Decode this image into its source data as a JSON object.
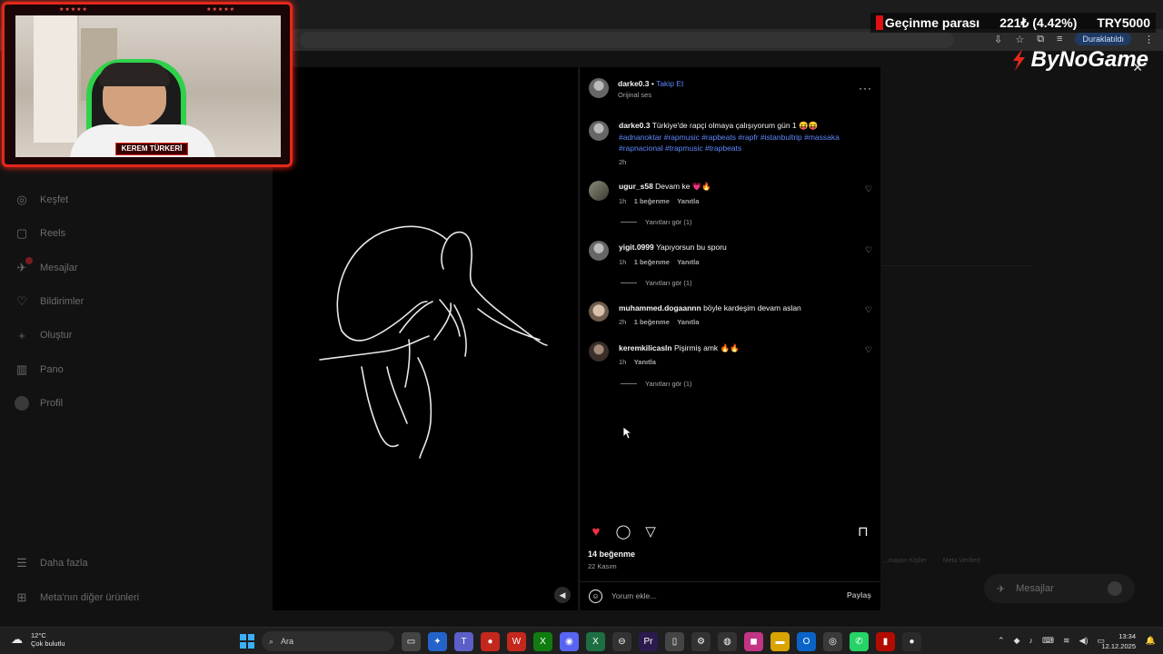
{
  "ticker": {
    "label": "Geçinme parası",
    "value": "221₺ (4.42%)",
    "goal": "TRY5000"
  },
  "brand": {
    "name": "ByNoGame"
  },
  "webcam": {
    "streamer_name": "KEREM TÜRKERİ"
  },
  "browser": {
    "paused_label": "Duraklatıldı"
  },
  "sidebar": {
    "items": [
      {
        "label": "Keşfet",
        "icon": "compass-icon"
      },
      {
        "label": "Reels",
        "icon": "reels-icon"
      },
      {
        "label": "Mesajlar",
        "icon": "messenger-icon"
      },
      {
        "label": "Bildirimler",
        "icon": "heart-icon"
      },
      {
        "label": "Oluştur",
        "icon": "plus-icon"
      },
      {
        "label": "Pano",
        "icon": "dashboard-icon"
      },
      {
        "label": "Profil",
        "icon": "avatar"
      }
    ],
    "bottom": [
      {
        "label": "Daha fazla",
        "icon": "menu-icon"
      },
      {
        "label": "Meta'nın diğer ürünleri",
        "icon": "grid-icon"
      }
    ]
  },
  "post": {
    "username": "darke0.3",
    "separator": "•",
    "follow": "Takip Et",
    "audio": "Orijinal ses",
    "caption_user": "darke0.3",
    "caption_text": "Türkiye'de rapçi olmaya çalışıyorum gün 1 😝😝",
    "hashtags": "#adnanoktar #rapmusic #rapbeats #rapfr #istanbultrip #massaka #rapnacional #trapmusic #trapbeats",
    "caption_time": "2h",
    "likes": "14 beğenme",
    "date": "22 Kasım",
    "comment_placeholder": "Yorum ekle...",
    "share": "Paylaş"
  },
  "comments": [
    {
      "user": "ugur_s58",
      "text": "Devam ke 💗🔥",
      "time": "1h",
      "likes": "1 beğenme",
      "reply": "Yanıtla",
      "view_replies": "Yanıtları gör (1)"
    },
    {
      "user": "yigit.0999",
      "text": "Yapıyorsun bu sporu",
      "time": "1h",
      "likes": "1 beğenme",
      "reply": "Yanıtla",
      "view_replies": "Yanıtları gör (1)"
    },
    {
      "user": "muhammed.dogaannn",
      "text": "böyle kardeşim devam aslan",
      "time": "2h",
      "likes": "1 beğenme",
      "reply": "Yanıtla"
    },
    {
      "user": "keremkilicasln",
      "text": "Pişirmiş amk 🔥🔥",
      "time": "1h",
      "reply": "Yanıtla",
      "view_replies": "Yanıtları gör (1)"
    }
  ],
  "right": {
    "footer_links": [
      "...mayan Kişiler",
      "Meta Verified"
    ],
    "messages_label": "Mesajlar"
  },
  "taskbar": {
    "temp": "12°C",
    "weather": "Çok bulutlu",
    "search": "Ara",
    "time": "13:34",
    "date": "12.12.2025"
  },
  "colors": {
    "accent_red": "#e3281b",
    "like_red": "#ff3040",
    "link_blue": "#5f88ff",
    "bg": "#000000"
  }
}
